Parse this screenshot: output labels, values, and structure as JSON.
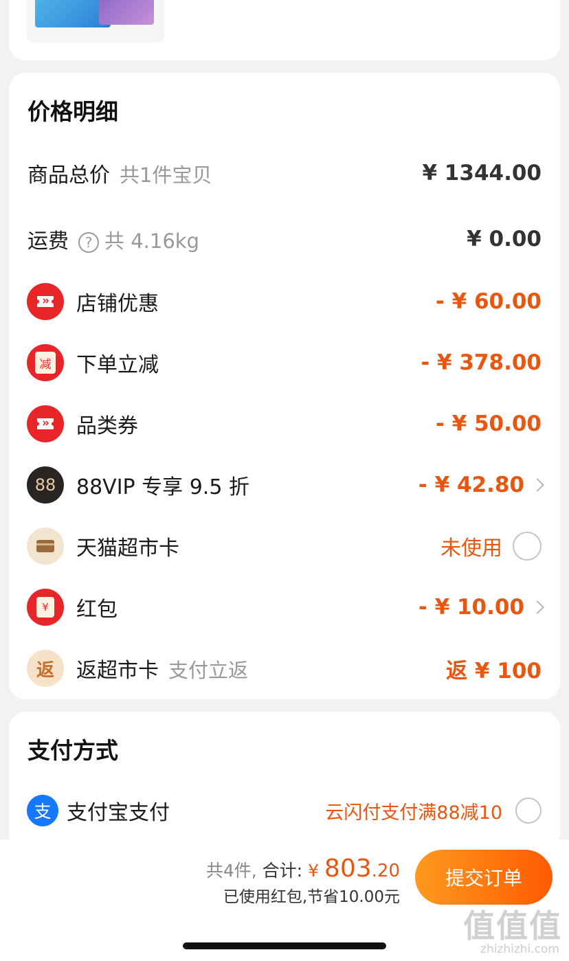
{
  "price_section": {
    "title": "价格明细",
    "subtotal": {
      "label": "商品总价",
      "sub": "共1件宝贝",
      "value": "¥ 1344.00"
    },
    "shipping": {
      "label": "运费",
      "sub": "共 4.16kg",
      "value": "¥ 0.00"
    },
    "store_discount": {
      "label": "店铺优惠",
      "value": "- ¥ 60.00"
    },
    "order_discount": {
      "label": "下单立减",
      "value": "- ¥ 378.00",
      "icon_char": "减"
    },
    "category_coupon": {
      "label": "品类券",
      "value": "- ¥ 50.00"
    },
    "vip": {
      "label": "88VIP 专享 9.5 折",
      "value": "- ¥ 42.80",
      "icon_char": "88"
    },
    "tmall_card": {
      "label": "天猫超市卡",
      "value": "未使用"
    },
    "red_packet": {
      "label": "红包",
      "value": "- ¥ 10.00",
      "icon_char": "¥"
    },
    "cashback": {
      "label": "返超市卡",
      "sub": "支付立返",
      "value": "返 ¥ 100",
      "icon_char": "返"
    }
  },
  "payment_section": {
    "title": "支付方式",
    "alipay": {
      "label": "支付宝支付",
      "promo": "云闪付支付满88减10",
      "icon_char": "支"
    }
  },
  "bottom_bar": {
    "count_text": "共4件,",
    "total_label": "合计:",
    "currency": "¥",
    "total_int": "803",
    "total_dec": ".20",
    "saving_text": "已使用红包,节省10.00元",
    "submit_label": "提交订单"
  },
  "watermark": {
    "text": "值值值",
    "url": "zhizhizhi.com"
  },
  "colors": {
    "accent": "#e8560f",
    "red_icon": "#e8262a",
    "button_start": "#ff9a1f",
    "button_end": "#ff5a00"
  }
}
